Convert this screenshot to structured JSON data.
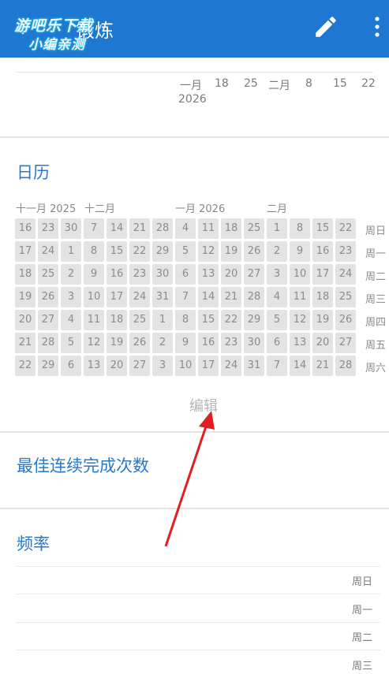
{
  "header": {
    "title": "锻炼",
    "watermark_line1": "游吧乐下载",
    "watermark_line2": "小编亲测",
    "color": "#1e78d2"
  },
  "top_chart_axis": {
    "labels": [
      "一月",
      "18",
      "25",
      "二月",
      "8",
      "15",
      "22"
    ],
    "year": "2026"
  },
  "calendar": {
    "title": "日历",
    "month_labels": [
      "十一月 2025",
      "十二月",
      "一月 2026",
      "二月"
    ],
    "weekday_labels": [
      "周日",
      "周一",
      "周二",
      "周三",
      "周四",
      "周五",
      "周六"
    ],
    "rows": [
      [
        "16",
        "23",
        "30",
        "7",
        "14",
        "21",
        "28",
        "4",
        "11",
        "18",
        "25",
        "1",
        "8",
        "15",
        "22"
      ],
      [
        "17",
        "24",
        "1",
        "8",
        "15",
        "22",
        "29",
        "5",
        "12",
        "19",
        "26",
        "2",
        "9",
        "16",
        "23"
      ],
      [
        "18",
        "25",
        "2",
        "9",
        "16",
        "23",
        "30",
        "6",
        "13",
        "20",
        "27",
        "3",
        "10",
        "17",
        "24"
      ],
      [
        "19",
        "26",
        "3",
        "10",
        "17",
        "24",
        "31",
        "7",
        "14",
        "21",
        "28",
        "4",
        "11",
        "18",
        "25"
      ],
      [
        "20",
        "27",
        "4",
        "11",
        "18",
        "25",
        "1",
        "8",
        "15",
        "22",
        "29",
        "5",
        "12",
        "19",
        "26"
      ],
      [
        "21",
        "28",
        "5",
        "12",
        "19",
        "26",
        "2",
        "9",
        "16",
        "23",
        "30",
        "6",
        "13",
        "20",
        "27"
      ],
      [
        "22",
        "29",
        "6",
        "13",
        "20",
        "27",
        "3",
        "10",
        "17",
        "24",
        "31",
        "7",
        "14",
        "21",
        "28"
      ]
    ],
    "edit_label": "编辑"
  },
  "best_streak": {
    "title": "最佳连续完成次数"
  },
  "frequency": {
    "title": "频率",
    "day_labels": [
      "周日",
      "周一",
      "周二",
      "周三"
    ]
  },
  "annotation_color": "#e02020"
}
